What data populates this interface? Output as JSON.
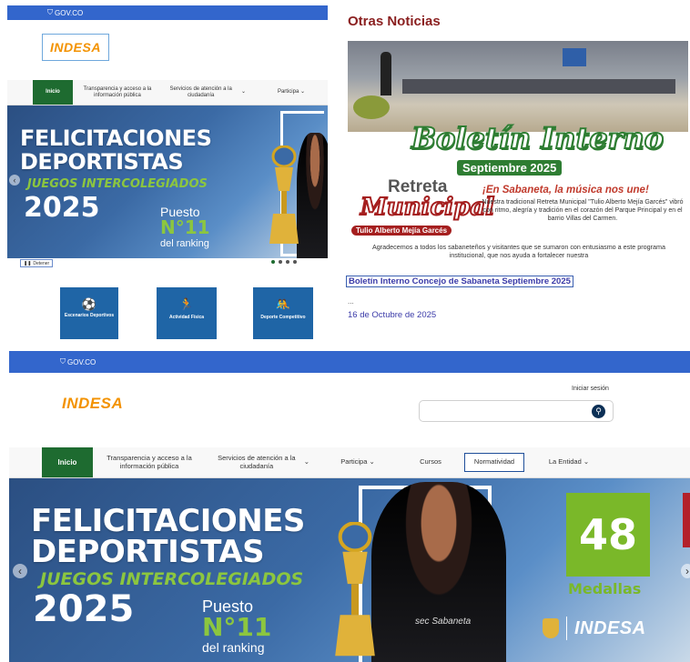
{
  "gov": {
    "label": "GOV.CO"
  },
  "brand": {
    "logo": "INDESA",
    "logo_color": "#f39200",
    "primary": "#1e6b30",
    "gov_blue": "#3366cc"
  },
  "nav": {
    "inicio": "Inicio",
    "transparencia": "Transparencia y acceso a la información pública",
    "servicios": "Servicios de atención a la ciudadanía",
    "participa": "Participa",
    "cursos": "Cursos",
    "normatividad": "Normatividad",
    "entidad": "La Entidad"
  },
  "banner": {
    "line1": "FELICITACIONES",
    "line2": "DEPORTISTAS",
    "line3": "JUEGOS INTERCOLEGIADOS",
    "year": "2025",
    "puesto": "Puesto",
    "rank_number": "N°11",
    "rank_text": "del ranking",
    "medals_count": "48",
    "medals_label": "Medallas",
    "jersey_text": "sec Sabaneta"
  },
  "carousel": {
    "stop_label": "Detener"
  },
  "services": [
    {
      "label": "Escenarios Deportivos",
      "icon": "soccer-ball-icon"
    },
    {
      "label": "Actividad Física",
      "icon": "running-person-icon"
    },
    {
      "label": "Deporte Competitivo",
      "icon": "competition-icon"
    }
  ],
  "news": {
    "heading": "Otras Noticias",
    "heading_color": "#8a1f1f",
    "img_title": "Boletín Interno",
    "img_subtitle": "Septiembre 2025",
    "retreta_top": "Retreta",
    "retreta_bottom": "Municipal",
    "tulio": "Tulio Alberto Mejía Garcés",
    "musica": "¡En Sabaneta, la música nos une!",
    "paragraph": "Nuestra tradicional Retreta Municipal \"Tulio Alberto Mejía Garcés\" vibró con ritmo, alegría y tradición en el corazón del Parque Principal y en el barrio Villas del Carmen.",
    "paragraph2": "Agradecemos a todos los sabaneteños y visitantes que se sumaron con entusiasmo a este programa institucional, que nos ayuda a fortalecer nuestra",
    "link": "Boletín Interno Concejo de Sabaneta Septiembre 2025",
    "ellipsis": "...",
    "date": "16 de Octubre de 2025"
  },
  "header2": {
    "login": "Iniciar sesión",
    "search_placeholder": ""
  }
}
